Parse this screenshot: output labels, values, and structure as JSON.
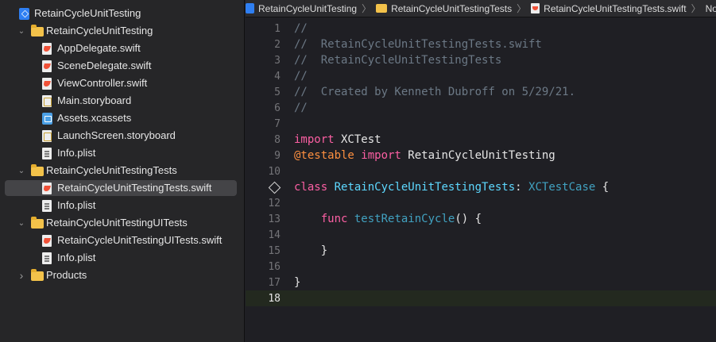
{
  "navigator": {
    "items": [
      {
        "label": "RetainCycleUnitTesting",
        "icon": "xcode-project-icon",
        "kind": "project"
      },
      {
        "label": "RetainCycleUnitTesting",
        "icon": "folder-icon",
        "kind": "folder",
        "expanded": true
      },
      {
        "label": "AppDelegate.swift",
        "icon": "swift-file-icon",
        "kind": "swift"
      },
      {
        "label": "SceneDelegate.swift",
        "icon": "swift-file-icon",
        "kind": "swift"
      },
      {
        "label": "ViewController.swift",
        "icon": "swift-file-icon",
        "kind": "swift"
      },
      {
        "label": "Main.storyboard",
        "icon": "storyboard-file-icon",
        "kind": "storyboard"
      },
      {
        "label": "Assets.xcassets",
        "icon": "asset-catalog-icon",
        "kind": "assets"
      },
      {
        "label": "LaunchScreen.storyboard",
        "icon": "storyboard-file-icon",
        "kind": "storyboard"
      },
      {
        "label": "Info.plist",
        "icon": "plist-file-icon",
        "kind": "plist"
      },
      {
        "label": "RetainCycleUnitTestingTests",
        "icon": "folder-icon",
        "kind": "folder",
        "expanded": true
      },
      {
        "label": "RetainCycleUnitTestingTests.swift",
        "icon": "swift-file-icon",
        "kind": "swift",
        "selected": true
      },
      {
        "label": "Info.plist",
        "icon": "plist-file-icon",
        "kind": "plist"
      },
      {
        "label": "RetainCycleUnitTestingUITests",
        "icon": "folder-icon",
        "kind": "folder",
        "expanded": true
      },
      {
        "label": "RetainCycleUnitTestingUITests.swift",
        "icon": "swift-file-icon",
        "kind": "swift"
      },
      {
        "label": "Info.plist",
        "icon": "plist-file-icon",
        "kind": "plist"
      },
      {
        "label": "Products",
        "icon": "folder-icon",
        "kind": "folder",
        "expanded": false
      }
    ]
  },
  "jumpbar": {
    "project": "RetainCycleUnitTesting",
    "group": "RetainCycleUnitTestingTests",
    "file": "RetainCycleUnitTestingTests.swift",
    "selection": "No Selection"
  },
  "editor": {
    "current_line": "18",
    "lines": [
      {
        "n": "1",
        "parts": [
          [
            "//",
            "comment"
          ]
        ]
      },
      {
        "n": "2",
        "parts": [
          [
            "//  RetainCycleUnitTestingTests.swift",
            "comment"
          ]
        ]
      },
      {
        "n": "3",
        "parts": [
          [
            "//  RetainCycleUnitTestingTests",
            "comment"
          ]
        ]
      },
      {
        "n": "4",
        "parts": [
          [
            "//",
            "comment"
          ]
        ]
      },
      {
        "n": "5",
        "parts": [
          [
            "//  Created by Kenneth Dubroff on 5/29/21.",
            "comment"
          ]
        ]
      },
      {
        "n": "6",
        "parts": [
          [
            "//",
            "comment"
          ]
        ]
      },
      {
        "n": "7",
        "parts": []
      },
      {
        "n": "8",
        "parts": [
          [
            "import",
            "kw"
          ],
          [
            " XCTest",
            "plain"
          ]
        ]
      },
      {
        "n": "9",
        "parts": [
          [
            "@testable",
            "attr"
          ],
          [
            " ",
            "plain"
          ],
          [
            "import",
            "kw"
          ],
          [
            " RetainCycleUnitTesting",
            "plain"
          ]
        ]
      },
      {
        "n": "10",
        "parts": []
      },
      {
        "n": "",
        "diamond": true,
        "parts": [
          [
            "class",
            "kw"
          ],
          [
            " ",
            "plain"
          ],
          [
            "RetainCycleUnitTestingTests",
            "type-decl"
          ],
          [
            ": ",
            "plain"
          ],
          [
            "XCTestCase",
            "type-ref"
          ],
          [
            " {",
            "plain"
          ]
        ]
      },
      {
        "n": "12",
        "parts": []
      },
      {
        "n": "13",
        "parts": [
          [
            "    ",
            "plain"
          ],
          [
            "func",
            "kw"
          ],
          [
            " ",
            "plain"
          ],
          [
            "testRetainCycle",
            "func-name"
          ],
          [
            "() {",
            "plain"
          ]
        ]
      },
      {
        "n": "14",
        "parts": []
      },
      {
        "n": "15",
        "parts": [
          [
            "    }",
            "plain"
          ]
        ]
      },
      {
        "n": "16",
        "parts": []
      },
      {
        "n": "17",
        "parts": [
          [
            "}",
            "plain"
          ]
        ]
      },
      {
        "n": "18",
        "parts": []
      }
    ]
  },
  "colors": {
    "background": "#1f1f24",
    "sidebar": "#262628",
    "selection": "#444447",
    "comment": "#6c7986",
    "keyword": "#fc5fa3",
    "type": "#5dd8ff",
    "attribute": "#fd8f3f",
    "current_line": "#23291f"
  }
}
